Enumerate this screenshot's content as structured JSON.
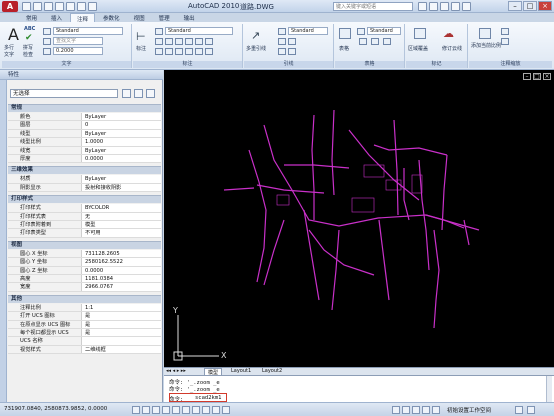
{
  "titlebar": {
    "app_name": "AutoCAD 2010",
    "file_name": "道路.DWG",
    "search_placeholder": "键入关键字或短语",
    "app_button": "A"
  },
  "tabs": [
    "常用",
    "插入",
    "注释",
    "参数化",
    "视图",
    "管理",
    "输出"
  ],
  "active_tab": "注释",
  "ribbon": {
    "text_panel": {
      "big_a_label": "A",
      "multiline_text": "多行",
      "multiline_text2": "文字",
      "spell_check": "检查",
      "spell_check_top": "拼写",
      "abc_label": "ABC",
      "style_value": "Standard",
      "find_text_placeholder": "查找文字",
      "height_value": "0.2000",
      "panel_label": "文字"
    },
    "dimension_panel": {
      "linear_label": "标注",
      "style_value": "Standard",
      "panel_label": "标注"
    },
    "leader_panel": {
      "multileader_label": "多重引线",
      "style_value": "Standard",
      "panel_label": "引线"
    },
    "table_panel": {
      "table_label": "表格",
      "style_value": "Standard",
      "panel_label": "表格"
    },
    "markup_panel": {
      "wipeout_label": "区域覆盖",
      "revcloud_label": "修订云线",
      "panel_label": "标记"
    },
    "scale_panel": {
      "add_current_label": "添加当前比例",
      "panel_label": "注释缩放"
    }
  },
  "palette": {
    "title": "特性",
    "selection": "无选择",
    "sections": [
      {
        "name": "常规",
        "rows": [
          {
            "k": "颜色",
            "v": "ByLayer"
          },
          {
            "k": "图层",
            "v": "0"
          },
          {
            "k": "线型",
            "v": "ByLayer"
          },
          {
            "k": "线型比例",
            "v": "1.0000"
          },
          {
            "k": "线宽",
            "v": "ByLayer"
          },
          {
            "k": "厚度",
            "v": "0.0000"
          }
        ]
      },
      {
        "name": "三维效果",
        "rows": [
          {
            "k": "材质",
            "v": "ByLayer"
          },
          {
            "k": "阴影显示",
            "v": "投射和接收阴影"
          }
        ]
      },
      {
        "name": "打印样式",
        "rows": [
          {
            "k": "打印样式",
            "v": "BYCOLOR"
          },
          {
            "k": "打印样式表",
            "v": "无"
          },
          {
            "k": "打印表附着到",
            "v": "模型"
          },
          {
            "k": "打印表类型",
            "v": "不可用"
          }
        ]
      },
      {
        "name": "视图",
        "rows": [
          {
            "k": "圆心 X 坐标",
            "v": "731128.2605"
          },
          {
            "k": "圆心 Y 坐标",
            "v": "2580162.5522"
          },
          {
            "k": "圆心 Z 坐标",
            "v": "0.0000"
          },
          {
            "k": "高度",
            "v": "1181.0384"
          },
          {
            "k": "宽度",
            "v": "2966.0767"
          }
        ]
      },
      {
        "name": "其他",
        "rows": [
          {
            "k": "注释比例",
            "v": "1:1"
          },
          {
            "k": "打开 UCS 图标",
            "v": "是"
          },
          {
            "k": "在原点显示 UCS 图标",
            "v": "是"
          },
          {
            "k": "每个视口都显示 UCS",
            "v": "是"
          },
          {
            "k": "UCS 名称",
            "v": ""
          },
          {
            "k": "视觉样式",
            "v": "二维线框"
          }
        ]
      }
    ]
  },
  "canvas": {
    "bg_color": "#000000",
    "road_color": "#c930c9",
    "ucs_x": "X",
    "ucs_y": "Y"
  },
  "layout_tabs": [
    "模型",
    "Layout1",
    "Layout2"
  ],
  "command": {
    "history": [
      "命令: '_.zoom _e",
      "命令: '_.zoom _e"
    ],
    "prompt": "命令:",
    "input": "scad2km1"
  },
  "status": {
    "coords": "731907.0840, 2580873.9852, 0.0000",
    "workspace": "初始设置工作空间"
  }
}
